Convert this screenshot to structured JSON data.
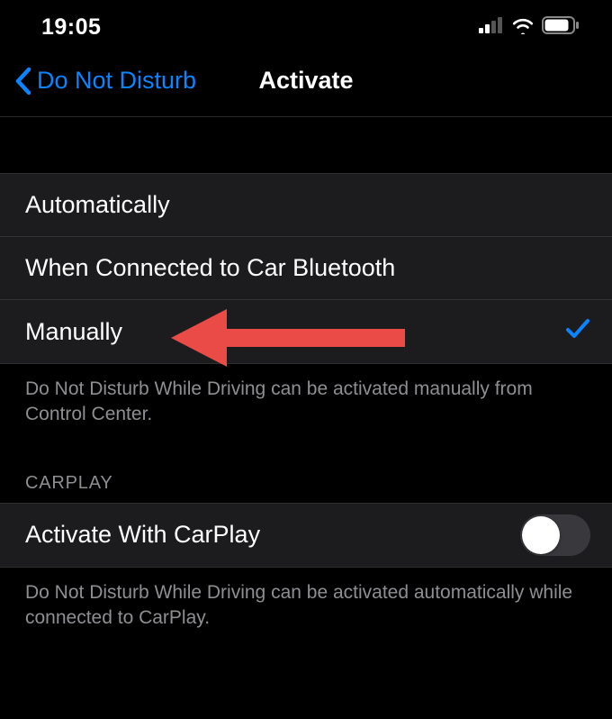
{
  "status": {
    "time": "19:05"
  },
  "nav": {
    "back_label": "Do Not Disturb",
    "title": "Activate"
  },
  "options": {
    "items": [
      {
        "label": "Automatically",
        "checked": false
      },
      {
        "label": "When Connected to Car Bluetooth",
        "checked": false
      },
      {
        "label": "Manually",
        "checked": true
      }
    ],
    "footer": "Do Not Disturb While Driving can be activated manually from Control Center."
  },
  "carplay": {
    "header": "CARPLAY",
    "toggle_label": "Activate With CarPlay",
    "toggle_on": false,
    "footer": "Do Not Disturb While Driving can be activated automatically while connected to CarPlay."
  }
}
